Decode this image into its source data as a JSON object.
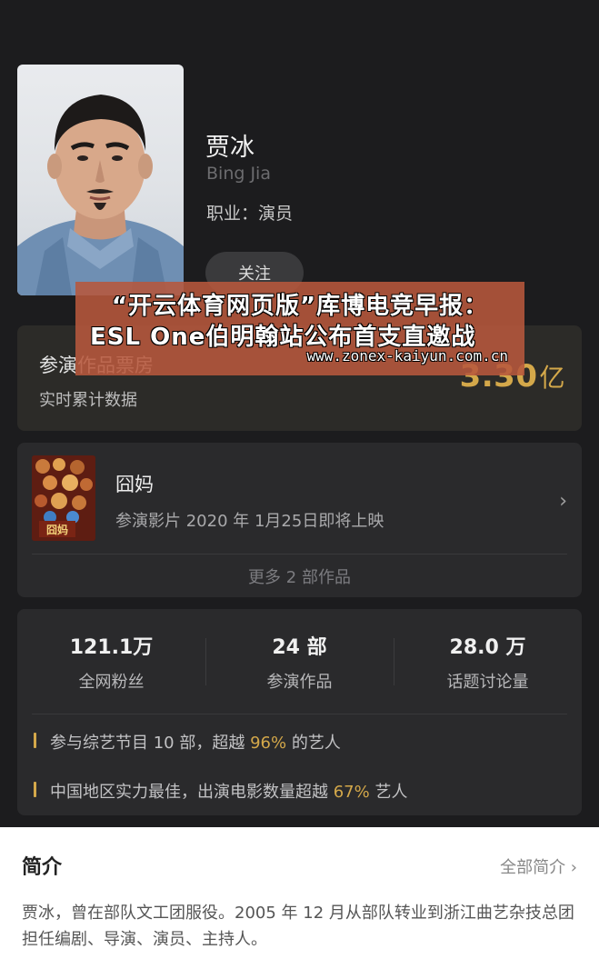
{
  "profile": {
    "name": "贾冰",
    "name_en": "Bing Jia",
    "occupation": "职业：演员",
    "follow_label": "关注"
  },
  "box_office": {
    "title": "参演作品票房",
    "subtitle": "实时累计数据",
    "value": "3.30",
    "unit": "亿"
  },
  "works": {
    "featured": {
      "title": "囧妈",
      "subtitle": "参演影片 2020 年 1月25日即将上映",
      "poster_text": "囧妈"
    },
    "more_label": "更多 2 部作品"
  },
  "stats": {
    "items": [
      {
        "value": "121.1万",
        "label": "全网粉丝"
      },
      {
        "value": "24 部",
        "label": "参演作品"
      },
      {
        "value": "28.0 万",
        "label": "话题讨论量"
      }
    ],
    "highlights": [
      {
        "prefix": "参与综艺节目 10 部，超越 ",
        "pct": "96%",
        "suffix": " 的艺人"
      },
      {
        "prefix": "中国地区实力最佳，出演电影数量超越 ",
        "pct": "67%",
        "suffix": " 艺人"
      }
    ]
  },
  "intro": {
    "title": "简介",
    "all_label": "全部简介 ›",
    "text": "贾冰，曾在部队文工团服役。2005 年 12 月从部队转业到浙江曲艺杂技总团担任编剧、导演、演员、主持人。"
  },
  "banner": {
    "line1": "“开云体育网页版”库博电竞早报：",
    "line2": "ESL One伯明翰站公布首支直邀战",
    "url": "www.zonex-kaiyun.com.cn"
  },
  "colors": {
    "background": "#1c1c1e",
    "accent_gold": "#d4a84a",
    "banner": "#b7583c"
  }
}
